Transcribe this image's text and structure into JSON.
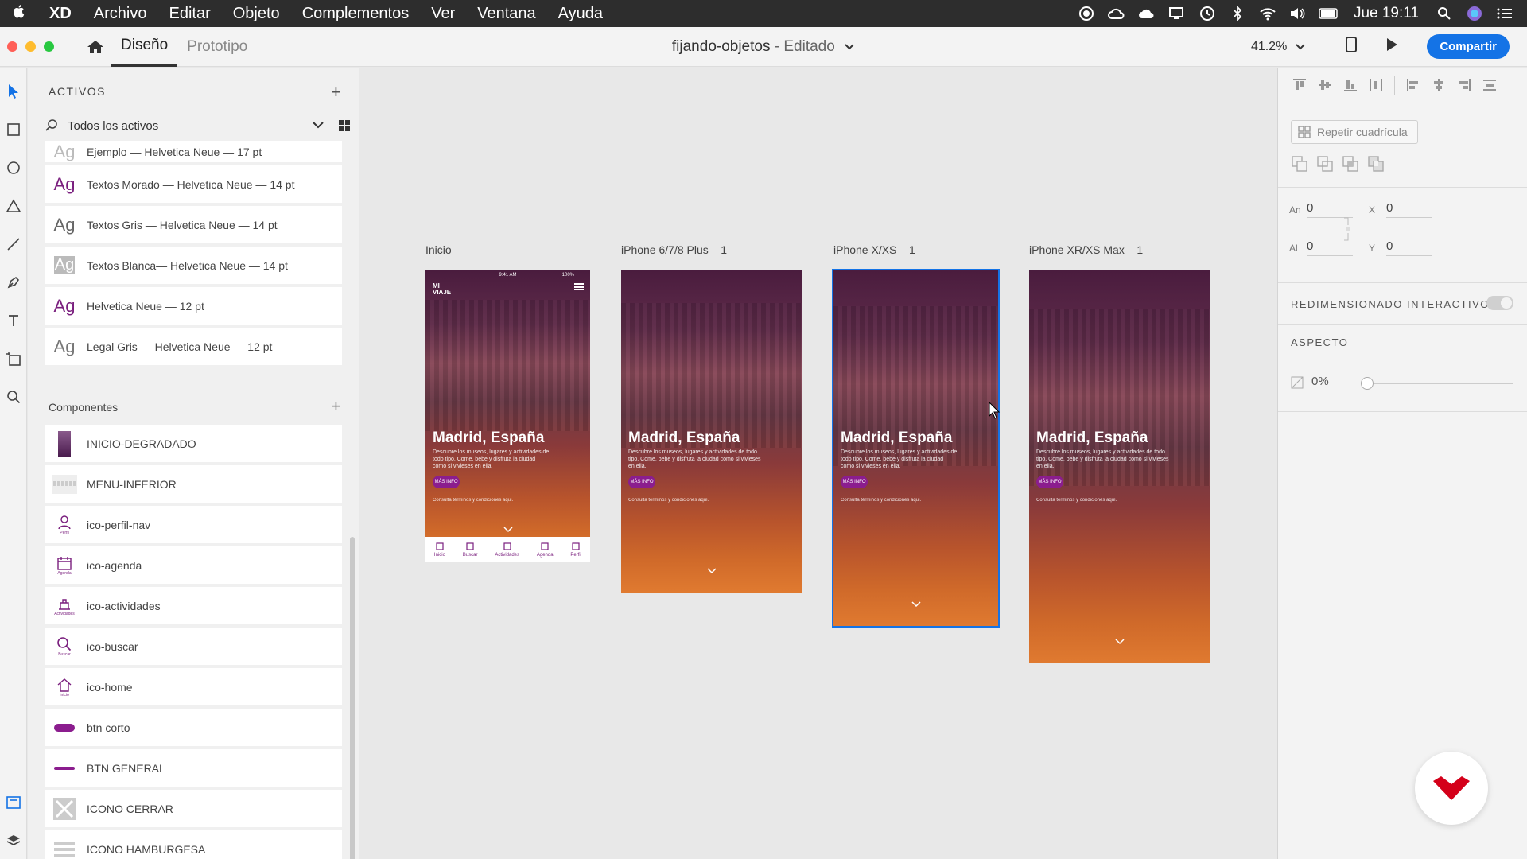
{
  "menubar": {
    "app": "XD",
    "items": [
      "Archivo",
      "Editar",
      "Objeto",
      "Complementos",
      "Ver",
      "Ventana",
      "Ayuda"
    ],
    "clock": "Jue 19:11"
  },
  "titlebar": {
    "tabs": [
      "Diseño",
      "Prototipo"
    ],
    "doc_name": "fijando-objetos",
    "doc_status": "- Editado",
    "zoom": "41.2%",
    "share": "Compartir"
  },
  "assets": {
    "header": "ACTIVOS",
    "filter": "Todos los activos",
    "char_styles": [
      {
        "glyph": "Ag",
        "label": "Ejemplo — Helvetica Neue — 17 pt",
        "color": "#bbbbbb"
      },
      {
        "glyph": "Ag",
        "label": "Textos Morado — Helvetica Neue — 14 pt",
        "color": "#7a1f7e"
      },
      {
        "glyph": "Ag",
        "label": "Textos Gris — Helvetica Neue — 14 pt",
        "color": "#666666"
      },
      {
        "glyph": "Ag",
        "label": "Textos Blanca— Helvetica Neue — 14 pt",
        "color": "#ffffff"
      },
      {
        "glyph": "Ag",
        "label": "Helvetica Neue — 12 pt",
        "color": "#7a1f7e"
      },
      {
        "glyph": "Ag",
        "label": "Legal Gris — Helvetica Neue — 12 pt",
        "color": "#777777"
      }
    ],
    "components_header": "Componentes",
    "components": [
      {
        "label": "INICIO-DEGRADADO",
        "icon": "gradient-thumb-icon",
        "caption": ""
      },
      {
        "label": "MENU-INFERIOR",
        "icon": "menu-bar-thumb-icon",
        "caption": ""
      },
      {
        "label": "ico-perfil-nav",
        "icon": "profile-icon",
        "caption": "Perfil"
      },
      {
        "label": "ico-agenda",
        "icon": "calendar-icon",
        "caption": "Agenda"
      },
      {
        "label": "ico-actividades",
        "icon": "activities-icon",
        "caption": "Actividades"
      },
      {
        "label": "ico-buscar",
        "icon": "search-icon",
        "caption": "Buscar"
      },
      {
        "label": "ico-home",
        "icon": "home-icon",
        "caption": "Inicio"
      },
      {
        "label": "btn corto",
        "icon": "short-button-thumb-icon",
        "caption": ""
      },
      {
        "label": "BTN GENERAL",
        "icon": "general-button-thumb-icon",
        "caption": ""
      },
      {
        "label": "ICONO CERRAR",
        "icon": "close-icon",
        "caption": ""
      },
      {
        "label": "ICONO HAMBURGESA",
        "icon": "hamburger-icon",
        "caption": ""
      }
    ]
  },
  "artboards": [
    {
      "name": "Inicio",
      "title": "Madrid, España",
      "desc": "Descubre los museos, lugares y actividades de todo tipo. Come, bebe y disfruta la ciudad como si vivieses en ella.",
      "btn": "MÁS INFO",
      "legal": "Consulta términos y condiciones aquí.",
      "status_time": "9:41 AM",
      "status_batt": "100%",
      "logo_line1": "MI",
      "logo_line2": "VIAJE",
      "nav": [
        "Inicio",
        "Buscar",
        "Actividades",
        "Agenda",
        "Perfil"
      ]
    },
    {
      "name": "iPhone 6/7/8 Plus – 1",
      "title": "Madrid, España",
      "desc": "Descubre los museos, lugares y actividades de todo tipo. Come, bebe y disfruta la ciudad como si vivieses en ella.",
      "btn": "MÁS INFO",
      "legal": "Consulta términos y condiciones aquí."
    },
    {
      "name": "iPhone X/XS – 1",
      "title": "Madrid, España",
      "desc": "Descubre los museos, lugares y actividades de todo tipo. Come, bebe y disfruta la ciudad como si vivieses en ella.",
      "btn": "MÁS INFO",
      "legal": "Consulta términos y condiciones aquí."
    },
    {
      "name": "iPhone XR/XS Max – 1",
      "title": "Madrid, España",
      "desc": "Descubre los museos, lugares y actividades de todo tipo. Come, bebe y disfruta la ciudad como si vivieses en ella.",
      "btn": "MÁS INFO",
      "legal": "Consulta términos y condiciones aquí."
    }
  ],
  "props": {
    "repeat_grid": "Repetir cuadrícula",
    "w_label": "An",
    "w_val": "0",
    "h_label": "Al",
    "h_val": "0",
    "x_label": "X",
    "x_val": "0",
    "y_label": "Y",
    "y_val": "0",
    "responsive": "REDIMENSIONADO INTERACTIVO",
    "appearance": "ASPECTO",
    "opacity": "0%"
  },
  "colors": {
    "accent": "#1473e6",
    "brand_purple": "#7a1f7e",
    "brand_red": "#d4001a"
  }
}
